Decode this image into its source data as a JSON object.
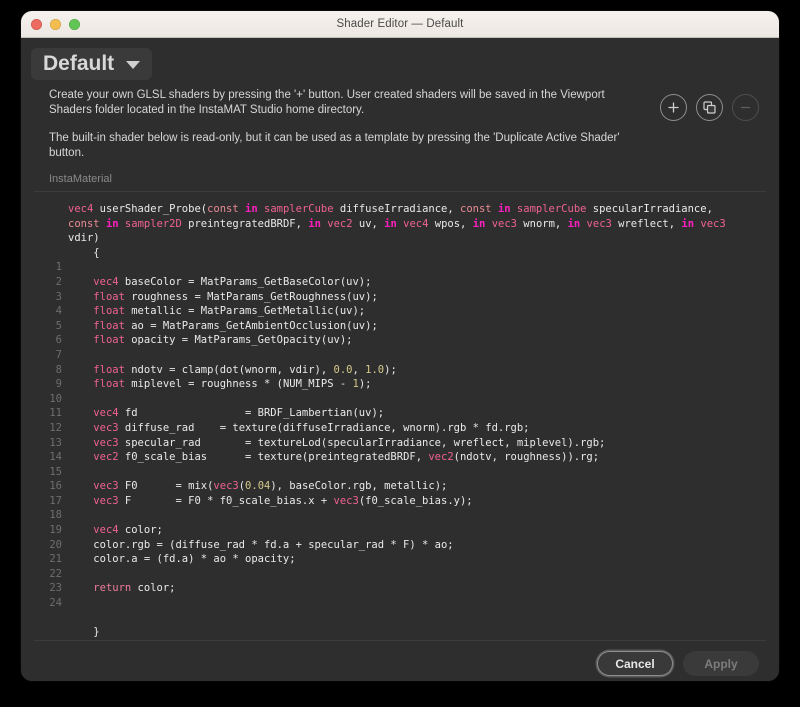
{
  "window": {
    "title": "Shader Editor — Default",
    "traffic_lights": [
      "close-red",
      "minimize-yellow",
      "maximize-green"
    ]
  },
  "header": {
    "shader_name": "Default",
    "dropdown_icon": "chevron-down-icon"
  },
  "description": {
    "paragraph1": "Create your own GLSL shaders by pressing the '+' button. User created shaders will be saved in the Viewport Shaders folder located in the InstaMAT Studio home directory.",
    "paragraph2": "The built-in shader below is read-only, but it can be used as a template by pressing the 'Duplicate Active Shader' button."
  },
  "toolbar": {
    "add": {
      "icon": "plus-icon",
      "title": "Add Shader",
      "enabled": true
    },
    "duplicate": {
      "icon": "duplicate-icon",
      "title": "Duplicate Active Shader",
      "enabled": true
    },
    "remove": {
      "icon": "minus-icon",
      "title": "Remove Shader",
      "enabled": false
    }
  },
  "subtitle": "InstaMaterial",
  "footer": {
    "cancel_label": "Cancel",
    "apply_label": "Apply",
    "apply_enabled": false
  },
  "colors": {
    "window_bg": "#2e2e2e",
    "titlebar_bg": "#f0ebe6",
    "type_token": "#f06292",
    "const_token": "#e98b94",
    "in_token": "#ff1fc0",
    "return_token": "#ef7a9c",
    "number_token": "#d4c98a",
    "plain_text": "#e9e9e9",
    "gutter_text": "#6e6e6e",
    "accent_focus_ring": "#5a5a5a"
  },
  "editor": {
    "language": "glsl",
    "read_only": true,
    "signature_lines": [
      [
        {
          "t": "vec4",
          "c": "type"
        },
        {
          "t": " userShader_Probe(",
          "c": "plain"
        },
        {
          "t": "const",
          "c": "const"
        },
        {
          "t": " ",
          "c": "plain"
        },
        {
          "t": "in",
          "c": "in"
        },
        {
          "t": " ",
          "c": "plain"
        },
        {
          "t": "samplerCube",
          "c": "type"
        },
        {
          "t": " diffuseIrradiance, ",
          "c": "plain"
        },
        {
          "t": "const",
          "c": "const"
        },
        {
          "t": " ",
          "c": "plain"
        },
        {
          "t": "in",
          "c": "in"
        },
        {
          "t": " ",
          "c": "plain"
        },
        {
          "t": "samplerCube",
          "c": "type"
        },
        {
          "t": " specularIrradiance,",
          "c": "plain"
        }
      ],
      [
        {
          "t": "const",
          "c": "const"
        },
        {
          "t": " ",
          "c": "plain"
        },
        {
          "t": "in",
          "c": "in"
        },
        {
          "t": " ",
          "c": "plain"
        },
        {
          "t": "sampler2D",
          "c": "type"
        },
        {
          "t": " preintegratedBRDF, ",
          "c": "plain"
        },
        {
          "t": "in",
          "c": "in"
        },
        {
          "t": " ",
          "c": "plain"
        },
        {
          "t": "vec2",
          "c": "type"
        },
        {
          "t": " uv, ",
          "c": "plain"
        },
        {
          "t": "in",
          "c": "in"
        },
        {
          "t": " ",
          "c": "plain"
        },
        {
          "t": "vec4",
          "c": "type"
        },
        {
          "t": " wpos, ",
          "c": "plain"
        },
        {
          "t": "in",
          "c": "in"
        },
        {
          "t": " ",
          "c": "plain"
        },
        {
          "t": "vec3",
          "c": "type"
        },
        {
          "t": " wnorm, ",
          "c": "plain"
        },
        {
          "t": "in",
          "c": "in"
        },
        {
          "t": " ",
          "c": "plain"
        },
        {
          "t": "vec3",
          "c": "type"
        },
        {
          "t": " wreflect, ",
          "c": "plain"
        },
        {
          "t": "in",
          "c": "in"
        },
        {
          "t": " ",
          "c": "plain"
        },
        {
          "t": "vec3",
          "c": "type"
        }
      ],
      [
        {
          "t": "vdir)",
          "c": "plain"
        }
      ],
      [
        {
          "t": "    {",
          "c": "plain"
        }
      ]
    ],
    "numbered_lines": [
      {
        "n": 1,
        "tokens": []
      },
      {
        "n": 2,
        "tokens": [
          {
            "t": "    ",
            "c": "plain"
          },
          {
            "t": "vec4",
            "c": "type"
          },
          {
            "t": " baseColor = MatParams_GetBaseColor(uv);",
            "c": "plain"
          }
        ]
      },
      {
        "n": 3,
        "tokens": [
          {
            "t": "    ",
            "c": "plain"
          },
          {
            "t": "float",
            "c": "type"
          },
          {
            "t": " roughness = MatParams_GetRoughness(uv);",
            "c": "plain"
          }
        ]
      },
      {
        "n": 4,
        "tokens": [
          {
            "t": "    ",
            "c": "plain"
          },
          {
            "t": "float",
            "c": "type"
          },
          {
            "t": " metallic = MatParams_GetMetallic(uv);",
            "c": "plain"
          }
        ]
      },
      {
        "n": 5,
        "tokens": [
          {
            "t": "    ",
            "c": "plain"
          },
          {
            "t": "float",
            "c": "type"
          },
          {
            "t": " ao = MatParams_GetAmbientOcclusion(uv);",
            "c": "plain"
          }
        ]
      },
      {
        "n": 6,
        "tokens": [
          {
            "t": "    ",
            "c": "plain"
          },
          {
            "t": "float",
            "c": "type"
          },
          {
            "t": " opacity = MatParams_GetOpacity(uv);",
            "c": "plain"
          }
        ]
      },
      {
        "n": 7,
        "tokens": []
      },
      {
        "n": 8,
        "tokens": [
          {
            "t": "    ",
            "c": "plain"
          },
          {
            "t": "float",
            "c": "type"
          },
          {
            "t": " ndotv = clamp(dot(wnorm, vdir), ",
            "c": "plain"
          },
          {
            "t": "0.0",
            "c": "num"
          },
          {
            "t": ", ",
            "c": "plain"
          },
          {
            "t": "1.0",
            "c": "num"
          },
          {
            "t": ");",
            "c": "plain"
          }
        ]
      },
      {
        "n": 9,
        "tokens": [
          {
            "t": "    ",
            "c": "plain"
          },
          {
            "t": "float",
            "c": "type"
          },
          {
            "t": " miplevel = roughness * (NUM_MIPS - ",
            "c": "plain"
          },
          {
            "t": "1",
            "c": "num"
          },
          {
            "t": ");",
            "c": "plain"
          }
        ]
      },
      {
        "n": 10,
        "tokens": []
      },
      {
        "n": 11,
        "tokens": [
          {
            "t": "    ",
            "c": "plain"
          },
          {
            "t": "vec4",
            "c": "type"
          },
          {
            "t": " fd                 = BRDF_Lambertian(uv);",
            "c": "plain"
          }
        ]
      },
      {
        "n": 12,
        "tokens": [
          {
            "t": "    ",
            "c": "plain"
          },
          {
            "t": "vec3",
            "c": "type"
          },
          {
            "t": " diffuse_rad    = texture(diffuseIrradiance, wnorm).rgb * fd.rgb;",
            "c": "plain"
          }
        ]
      },
      {
        "n": 13,
        "tokens": [
          {
            "t": "    ",
            "c": "plain"
          },
          {
            "t": "vec3",
            "c": "type"
          },
          {
            "t": " specular_rad       = textureLod(specularIrradiance, wreflect, miplevel).rgb;",
            "c": "plain"
          }
        ]
      },
      {
        "n": 14,
        "tokens": [
          {
            "t": "    ",
            "c": "plain"
          },
          {
            "t": "vec2",
            "c": "type"
          },
          {
            "t": " f0_scale_bias      = texture(preintegratedBRDF, ",
            "c": "plain"
          },
          {
            "t": "vec2",
            "c": "type"
          },
          {
            "t": "(ndotv, roughness)).rg;",
            "c": "plain"
          }
        ]
      },
      {
        "n": 15,
        "tokens": []
      },
      {
        "n": 16,
        "tokens": [
          {
            "t": "    ",
            "c": "plain"
          },
          {
            "t": "vec3",
            "c": "type"
          },
          {
            "t": " F0      = mix(",
            "c": "plain"
          },
          {
            "t": "vec3",
            "c": "type"
          },
          {
            "t": "(",
            "c": "plain"
          },
          {
            "t": "0.04",
            "c": "num"
          },
          {
            "t": "), baseColor.rgb, metallic);",
            "c": "plain"
          }
        ]
      },
      {
        "n": 17,
        "tokens": [
          {
            "t": "    ",
            "c": "plain"
          },
          {
            "t": "vec3",
            "c": "type"
          },
          {
            "t": " F       = F0 * f0_scale_bias.x + ",
            "c": "plain"
          },
          {
            "t": "vec3",
            "c": "type"
          },
          {
            "t": "(f0_scale_bias.y);",
            "c": "plain"
          }
        ]
      },
      {
        "n": 18,
        "tokens": []
      },
      {
        "n": 19,
        "tokens": [
          {
            "t": "    ",
            "c": "plain"
          },
          {
            "t": "vec4",
            "c": "type"
          },
          {
            "t": " color;",
            "c": "plain"
          }
        ]
      },
      {
        "n": 20,
        "tokens": [
          {
            "t": "    color.rgb = (diffuse_rad * fd.a + specular_rad * F) * ao;",
            "c": "plain"
          }
        ]
      },
      {
        "n": 21,
        "tokens": [
          {
            "t": "    color.a = (fd.a) * ao * opacity;",
            "c": "plain"
          }
        ]
      },
      {
        "n": 22,
        "tokens": []
      },
      {
        "n": 23,
        "tokens": [
          {
            "t": "    ",
            "c": "plain"
          },
          {
            "t": "return",
            "c": "ret"
          },
          {
            "t": " color;",
            "c": "plain"
          }
        ]
      },
      {
        "n": 24,
        "tokens": []
      }
    ],
    "trailing_lines": [
      [],
      [
        {
          "t": "    }",
          "c": "plain"
        }
      ]
    ]
  }
}
